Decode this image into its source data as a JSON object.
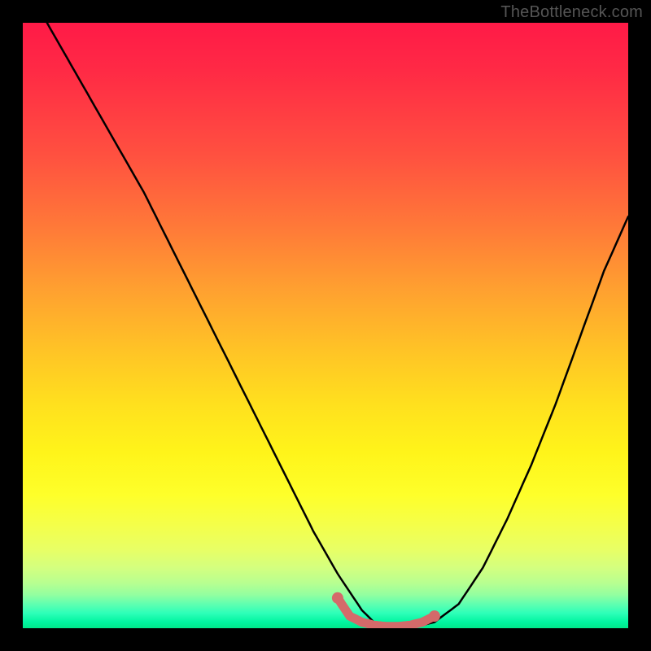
{
  "watermark": "TheBottleneck.com",
  "colors": {
    "background": "#000000",
    "curve": "#000000",
    "accent": "#d46a6a",
    "gradient_top": "#ff1a47",
    "gradient_mid": "#ffe01e",
    "gradient_bottom": "#00e88a"
  },
  "chart_data": {
    "type": "line",
    "title": "",
    "xlabel": "",
    "ylabel": "",
    "xlim": [
      0,
      100
    ],
    "ylim": [
      0,
      100
    ],
    "series": [
      {
        "name": "bottleneck-curve",
        "x": [
          4,
          8,
          12,
          16,
          20,
          24,
          28,
          32,
          36,
          40,
          44,
          48,
          52,
          56,
          58,
          60,
          64,
          68,
          72,
          76,
          80,
          84,
          88,
          92,
          96,
          100
        ],
        "y": [
          100,
          93,
          86,
          79,
          72,
          64,
          56,
          48,
          40,
          32,
          24,
          16,
          9,
          3,
          1,
          0,
          0,
          1,
          4,
          10,
          18,
          27,
          37,
          48,
          59,
          68
        ]
      },
      {
        "name": "optimal-zone",
        "x": [
          52,
          54,
          56,
          58,
          60,
          62,
          64,
          66,
          68
        ],
        "y": [
          5,
          2,
          1,
          0.5,
          0.3,
          0.3,
          0.5,
          1,
          2
        ]
      }
    ],
    "annotations": []
  }
}
